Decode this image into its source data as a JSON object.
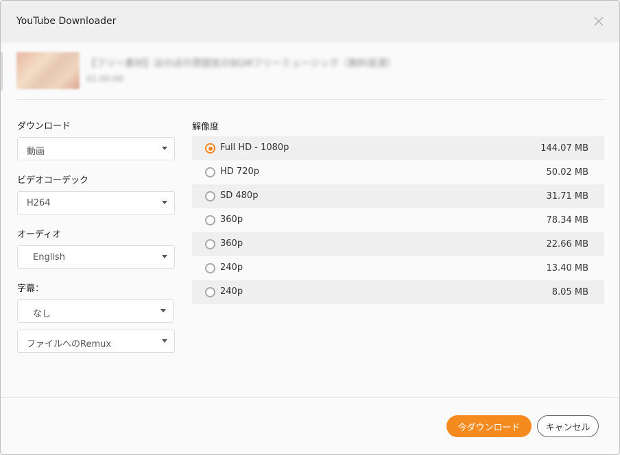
{
  "window": {
    "title": "YouTube Downloader"
  },
  "video": {
    "title": "【フリー素材】ほのぼの雰囲気のBGMフリーミュージック（無料音源）",
    "duration": "01:00:00"
  },
  "settings": {
    "download_label": "ダウンロード",
    "download_value": "動画",
    "codec_label": "ビデオコーデック",
    "codec_value": "H264",
    "audio_label": "オーディオ",
    "audio_value": "English",
    "subtitle_label": "字幕：",
    "subtitle_value": "なし",
    "remux_value": "ファイルへのRemux"
  },
  "resolution": {
    "label": "解像度",
    "items": [
      {
        "name": "Full HD - 1080p",
        "size": "144.07 MB",
        "selected": true
      },
      {
        "name": "HD 720p",
        "size": "50.02 MB",
        "selected": false
      },
      {
        "name": "SD 480p",
        "size": "31.71 MB",
        "selected": false
      },
      {
        "name": "360p",
        "size": "78.34 MB",
        "selected": false
      },
      {
        "name": "360p",
        "size": "22.66 MB",
        "selected": false
      },
      {
        "name": "240p",
        "size": "13.40 MB",
        "selected": false
      },
      {
        "name": "240p",
        "size": "8.05 MB",
        "selected": false
      }
    ]
  },
  "buttons": {
    "download": "今ダウンロード",
    "cancel": "キャンセル"
  },
  "colors": {
    "accent": "#f58a1e"
  },
  "icons": {
    "close": "close-icon",
    "dropdown": "chevron-down-icon",
    "radio": "radio-icon"
  }
}
